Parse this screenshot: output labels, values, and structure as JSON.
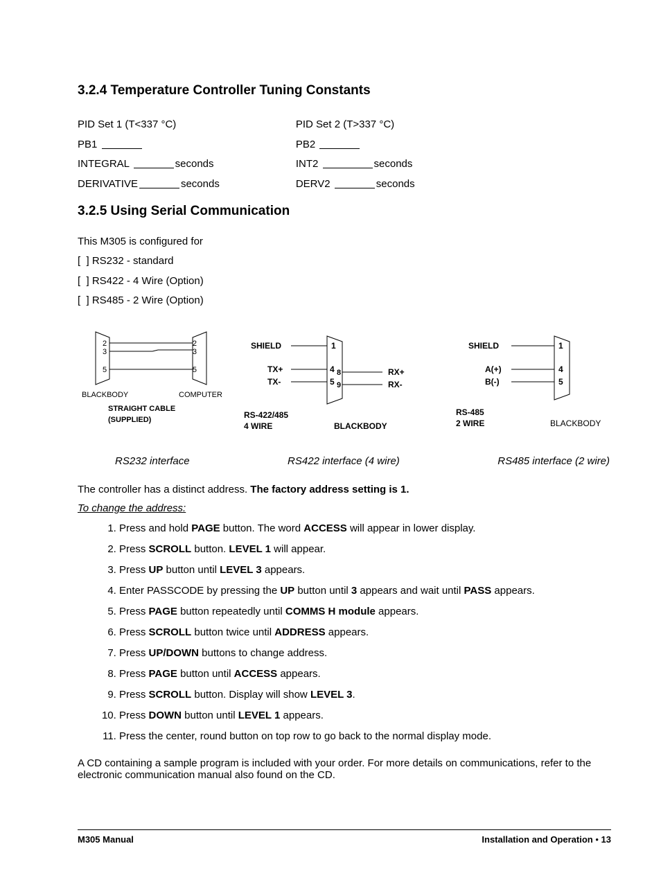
{
  "section324": {
    "heading": "3.2.4  Temperature Controller Tuning Constants",
    "pid1": {
      "title": "PID Set 1 (T<337 °C)",
      "pb": "PB1",
      "integral": "INTEGRAL",
      "derivative": "DERIVATIVE",
      "unit": "seconds"
    },
    "pid2": {
      "title": "PID Set 2 (T>337 °C)",
      "pb": "PB2",
      "integral": "INT2",
      "derivative": "DERV2",
      "unit": "seconds"
    }
  },
  "section325": {
    "heading": "3.2.5  Using Serial Communication",
    "intro": "This M305 is configured for",
    "opts": [
      "[  ] RS232 - standard",
      "[  ] RS422 - 4 Wire (Option)",
      "[  ] RS485 - 2 Wire (Option)"
    ],
    "captions": {
      "c1": "RS232 interface",
      "c2": "RS422 interface (4 wire)",
      "c3": "RS485 interface (2 wire)"
    },
    "address_line_a": "The controller has a distinct address.  ",
    "address_line_b": "The factory address setting is  1.",
    "change_heading": "To change the address:",
    "steps": [
      {
        "pre": "Press and hold ",
        "b1": "PAGE",
        "mid": " button. The word ",
        "b2": "ACCESS",
        "post": " will appear in lower display."
      },
      {
        "pre": "Press ",
        "b1": "SCROLL",
        "mid": " button. ",
        "b2": "LEVEL 1",
        "post": " will appear."
      },
      {
        "pre": "Press ",
        "b1": "UP",
        "mid": " button until ",
        "b2": "LEVEL 3",
        "post": " appears."
      },
      {
        "pre": "Enter PASSCODE by pressing the ",
        "b1": "UP",
        "mid": " button until ",
        "b2": "3",
        "post_mid": " appears and wait until ",
        "b3": "PASS",
        "post": " appears."
      },
      {
        "pre": "Press ",
        "b1": "PAGE",
        "mid": " button repeatedly until ",
        "b2": "COMMS H module",
        "post": " appears."
      },
      {
        "pre": "Press ",
        "b1": "SCROLL",
        "mid": " button twice until ",
        "b2": "ADDRESS",
        "post": " appears."
      },
      {
        "pre": "Press ",
        "b1": "UP/DOWN",
        "mid": " buttons to change address.",
        "b2": "",
        "post": ""
      },
      {
        "pre": "Press ",
        "b1": "PAGE",
        "mid": " button until ",
        "b2": "ACCESS",
        "post": " appears."
      },
      {
        "pre": "Press ",
        "b1": "SCROLL",
        "mid": " button. Display will show ",
        "b2": "LEVEL 3",
        "post": "."
      },
      {
        "pre": "Press ",
        "b1": "DOWN",
        "mid": " button until ",
        "b2": "LEVEL 1",
        "post": " appears."
      },
      {
        "pre": "Press the center, round button on top row to go back to the normal display mode.",
        "b1": "",
        "mid": "",
        "b2": "",
        "post": ""
      }
    ],
    "closing": "A CD containing a sample program is included with your order.  For more details on communications, refer to the electronic communication manual also found on the CD."
  },
  "diagram": {
    "rs232": {
      "pins": [
        "2",
        "3",
        "5"
      ],
      "left_label": "BLACKBODY",
      "right_label": "COMPUTER",
      "sub1": "STRAIGHT CABLE",
      "sub2": "(SUPPLIED)"
    },
    "rs422": {
      "labels": {
        "shield": "SHIELD",
        "txp": "TX+",
        "txm": "TX-",
        "rxp": "RX+",
        "rxm": "RX-"
      },
      "pins": {
        "p1": "1",
        "p4": "4",
        "p5": "5",
        "p8": "8",
        "p9": "9"
      },
      "bottom_left_a": "RS-422/485",
      "bottom_left_b": "4 WIRE",
      "bottom_right": "BLACKBODY"
    },
    "rs485": {
      "labels": {
        "shield": "SHIELD",
        "a": "A(+)",
        "b": "B(-)"
      },
      "pins": {
        "p1": "1",
        "p4": "4",
        "p5": "5"
      },
      "bottom_left_a": "RS-485",
      "bottom_left_b": "2 WIRE",
      "bottom_right": "BLACKBODY"
    }
  },
  "footer": {
    "left": "M305 Manual",
    "right_a": "Installation and Operation ",
    "right_dot": "•",
    "right_b": "  13"
  }
}
